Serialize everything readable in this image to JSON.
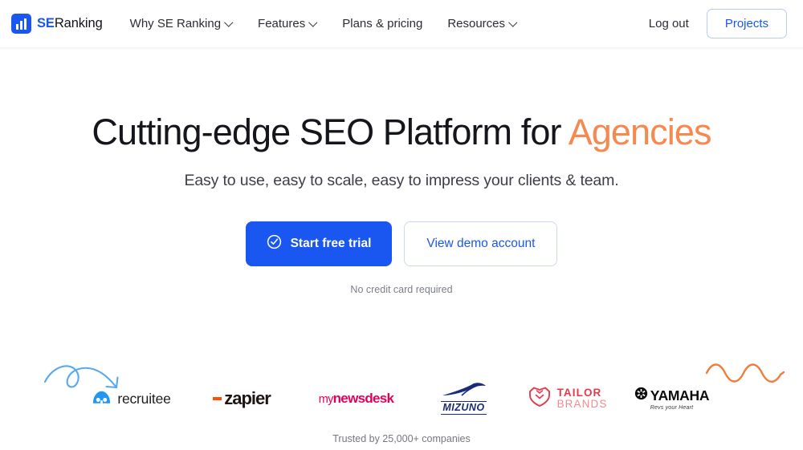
{
  "brand": {
    "name_bold": "SE",
    "name_rest": "Ranking",
    "logo_icon": "bar-chart-icon",
    "accent_color": "#1a56f0"
  },
  "nav": {
    "links": [
      {
        "label": "Why SE Ranking",
        "has_chevron": true
      },
      {
        "label": "Features",
        "has_chevron": true
      },
      {
        "label": "Plans & pricing",
        "has_chevron": false
      },
      {
        "label": "Resources",
        "has_chevron": true
      }
    ],
    "logout_label": "Log out",
    "projects_label": "Projects"
  },
  "hero": {
    "headline_main": "Cutting-edge SEO Platform for ",
    "headline_accent": "Agencies",
    "headline_accent_color": "#f5894f",
    "subheadline": "Easy to use, easy to scale, easy to impress your clients & team.",
    "primary_cta": "Start free trial",
    "primary_cta_icon": "check-circle-icon",
    "secondary_cta": "View demo account",
    "note": "No credit card required",
    "decorations": [
      {
        "name": "curved-arrow-doodle",
        "color": "#57a8ee"
      },
      {
        "name": "wavy-line-doodle",
        "color": "#f07d3c"
      }
    ]
  },
  "logos": {
    "items": [
      {
        "name": "recruitee",
        "label": "recruitee",
        "color": "#1d1d1f",
        "icon_color": "#2196f3"
      },
      {
        "name": "zapier",
        "label": "zapier",
        "color": "#201515",
        "icon_color": "#ff4f00"
      },
      {
        "name": "mynewsdesk",
        "label_prefix": "my",
        "label": "newsdesk",
        "color": "#e6005a"
      },
      {
        "name": "mizuno",
        "label": "MIZUNO",
        "color": "#1a2b7a"
      },
      {
        "name": "tailor-brands",
        "label": "TAILOR",
        "label2": "BRANDS",
        "color": "#e8394a"
      },
      {
        "name": "yamaha",
        "label": "YAMAHA",
        "tagline": "Revs your Heart",
        "color": "#0c0c0c"
      }
    ],
    "trusted_text": "Trusted by 25,000+ companies"
  }
}
